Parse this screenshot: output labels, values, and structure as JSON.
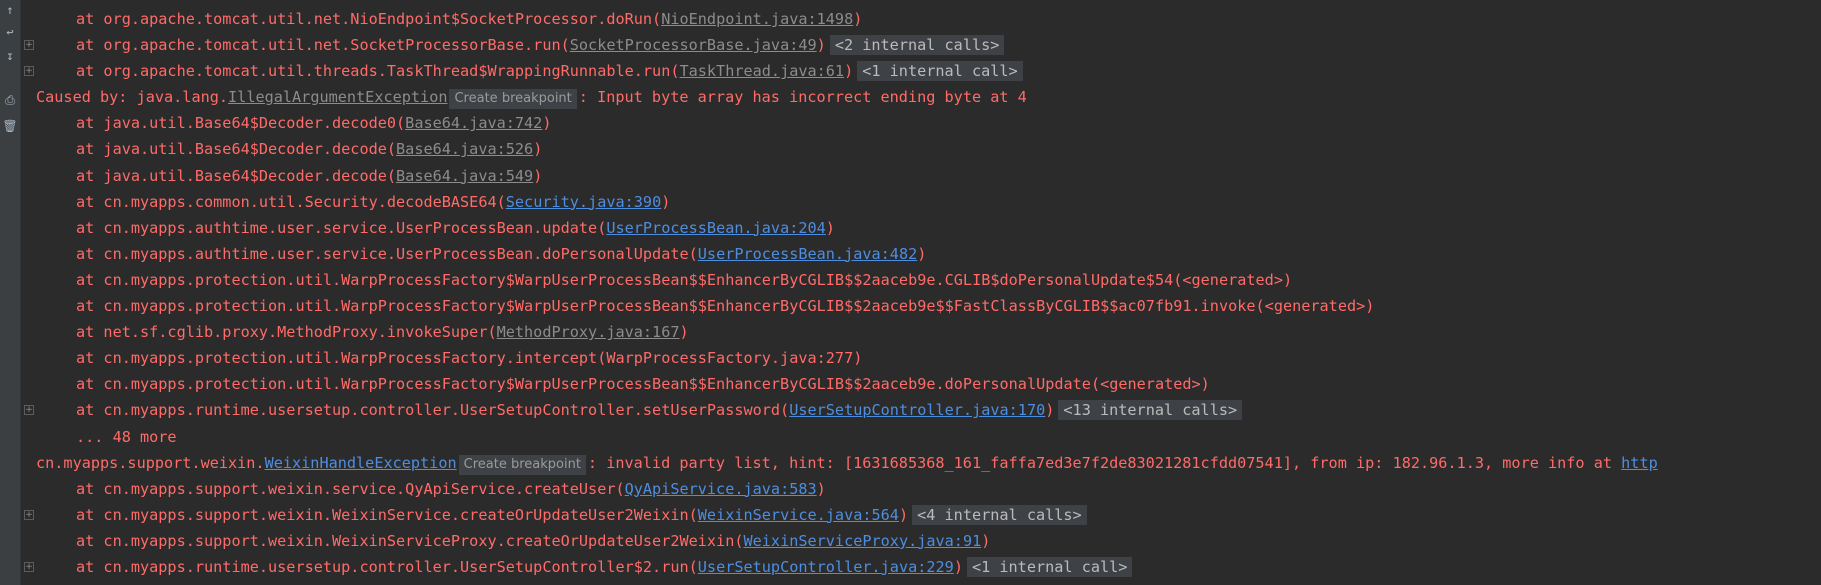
{
  "toolbar_icons": [
    "soft-wrap-icon",
    "scroll-to-end-icon",
    "print-icon",
    "clear-all-icon"
  ],
  "colors": {
    "error_text": "#ff6b68",
    "link": "#4e8ee0",
    "lib_link": "#8c8c8c",
    "background": "#2b2b2b"
  },
  "lines": [
    {
      "prefix": "at org.apache.tomcat.util.net.NioEndpoint$SocketProcessor.doRun(",
      "link": "NioEndpoint.java:1498",
      "suffix": ")"
    },
    {
      "prefix": "at org.apache.tomcat.util.net.SocketProcessorBase.run(",
      "link": "SocketProcessorBase.java:49",
      "suffix": ")",
      "badge": "<2 internal calls>"
    },
    {
      "prefix": "at org.apache.tomcat.util.threads.TaskThread$WrappingRunnable.run(",
      "link": "TaskThread.java:61",
      "suffix": ")",
      "badge": "<1 internal call>"
    },
    {
      "caused_prefix": "Caused by: java.lang.",
      "exception": "IllegalArgumentException",
      "hint": "Create breakpoint",
      "message": ": Input byte array has incorrect ending byte at 4"
    },
    {
      "prefix": "at java.util.Base64$Decoder.decode0(",
      "link": "Base64.java:742",
      "suffix": ")"
    },
    {
      "prefix": "at java.util.Base64$Decoder.decode(",
      "link": "Base64.java:526",
      "suffix": ")"
    },
    {
      "prefix": "at java.util.Base64$Decoder.decode(",
      "link": "Base64.java:549",
      "suffix": ")"
    },
    {
      "prefix": "at cn.myapps.common.util.Security.decodeBASE64(",
      "link": "Security.java:390",
      "suffix": ")"
    },
    {
      "prefix": "at cn.myapps.authtime.user.service.UserProcessBean.update(",
      "link": "UserProcessBean.java:204",
      "suffix": ")"
    },
    {
      "prefix": "at cn.myapps.authtime.user.service.UserProcessBean.doPersonalUpdate(",
      "link": "UserProcessBean.java:482",
      "suffix": ")"
    },
    {
      "text": "at cn.myapps.protection.util.WarpProcessFactory$WarpUserProcessBean$$EnhancerByCGLIB$$2aaceb9e.CGLIB$doPersonalUpdate$54(<generated>)"
    },
    {
      "text": "at cn.myapps.protection.util.WarpProcessFactory$WarpUserProcessBean$$EnhancerByCGLIB$$2aaceb9e$$FastClassByCGLIB$$ac07fb91.invoke(<generated>)"
    },
    {
      "prefix": "at net.sf.cglib.proxy.MethodProxy.invokeSuper(",
      "link": "MethodProxy.java:167",
      "suffix": ")"
    },
    {
      "text": "at cn.myapps.protection.util.WarpProcessFactory.intercept(WarpProcessFactory.java:277)"
    },
    {
      "text": "at cn.myapps.protection.util.WarpProcessFactory$WarpUserProcessBean$$EnhancerByCGLIB$$2aaceb9e.doPersonalUpdate(<generated>)"
    },
    {
      "prefix": "at cn.myapps.runtime.usersetup.controller.UserSetupController.setUserPassword(",
      "link": "UserSetupController.java:170",
      "suffix": ")",
      "badge": "<13 internal calls>"
    },
    {
      "text": "... 48 more"
    },
    {
      "caused_prefix": "cn.myapps.support.weixin.",
      "exception": "WeixinHandleException",
      "hint": "Create breakpoint",
      "message": ": invalid party list, hint: [1631685368_161_faffa7ed3e7f2de83021281cfdd07541], from ip: 182.96.1.3, more info at ",
      "trailing_link": "http"
    },
    {
      "prefix": "at cn.myapps.support.weixin.service.QyApiService.createUser(",
      "link": "QyApiService.java:583",
      "suffix": ")"
    },
    {
      "prefix": "at cn.myapps.support.weixin.WeixinService.createOrUpdateUser2Weixin(",
      "link": "WeixinService.java:564",
      "suffix": ")",
      "badge": "<4 internal calls>"
    },
    {
      "prefix": "at cn.myapps.support.weixin.WeixinServiceProxy.createOrUpdateUser2Weixin(",
      "link": "WeixinServiceProxy.java:91",
      "suffix": ")"
    },
    {
      "prefix": "at cn.myapps.runtime.usersetup.controller.UserSetupController$2.run(",
      "link": "UserSetupController.java:229",
      "suffix": ")",
      "badge": "<1 internal call>"
    }
  ]
}
